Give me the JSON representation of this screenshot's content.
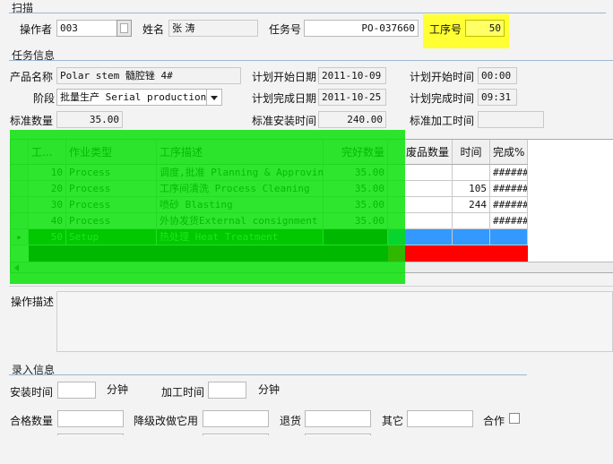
{
  "sections": {
    "scan": "扫描",
    "task_info": "任务信息",
    "entry_info": "录入信息"
  },
  "scan": {
    "operator_label": "操作者",
    "operator_value": "003",
    "name_label": "姓名",
    "name_value": "张  涛",
    "task_no_label": "任务号",
    "task_no_value": "PO-037660",
    "process_no_label": "工序号",
    "process_no_value": "50"
  },
  "task": {
    "product_label": "产品名称",
    "product_value": "Polar stem 髓腔锉 4#",
    "plan_start_date_label": "计划开始日期",
    "plan_start_date_value": "2011-10-09",
    "plan_start_time_label": "计划开始时间",
    "plan_start_time_value": "00:00",
    "stage_label": "阶段",
    "stage_value": "批量生产 Serial production",
    "plan_end_date_label": "计划完成日期",
    "plan_end_date_value": "2011-10-25",
    "plan_end_time_label": "计划完成时间",
    "plan_end_time_value": "09:31",
    "std_qty_label": "标准数量",
    "std_qty_value": "35.00",
    "std_install_time_label": "标准安装时间",
    "std_install_time_value": "240.00",
    "std_process_time_label": "标准加工时间",
    "std_process_time_value": ""
  },
  "grid": {
    "headers": [
      "工...",
      "作业类型",
      "工序描述",
      "完好数量",
      "废品数量",
      "时间",
      "完成%"
    ],
    "rows": [
      {
        "no": "10",
        "type": "Process",
        "desc": "调度,批准 Planning & Approving",
        "good": "35.00",
        "scrap": "",
        "time": "",
        "done": "######"
      },
      {
        "no": "20",
        "type": "Process",
        "desc": "工序间清洗 Process Cleaning",
        "good": "35.00",
        "scrap": "",
        "time": "105",
        "done": "######"
      },
      {
        "no": "30",
        "type": "Process",
        "desc": "喷砂 Blasting",
        "good": "35.00",
        "scrap": "",
        "time": "244",
        "done": "######"
      },
      {
        "no": "40",
        "type": "Process",
        "desc": "外协发货External consignment",
        "good": "35.00",
        "scrap": "",
        "time": "",
        "done": "######"
      },
      {
        "no": "50",
        "type": "Setup",
        "desc": "热处理 Heat Treatment",
        "good": "",
        "scrap": "",
        "time": "",
        "done": ""
      }
    ],
    "row_indicator": "▸"
  },
  "op_desc_label": "操作描述",
  "entry": {
    "install_time_label": "安装时间",
    "install_unit": "分钟",
    "process_time_label": "加工时间",
    "process_unit": "分钟",
    "pass_qty_label": "合格数量",
    "downgrade_label": "降级改做它用",
    "return_label": "退货",
    "other_label": "其它",
    "co_work_label": "合作"
  },
  "colors": {
    "highlight_yellow": "#ffff33",
    "highlight_green": "#00e000",
    "selected_row_blue": "#3399ff",
    "error_red": "#ff0000"
  }
}
